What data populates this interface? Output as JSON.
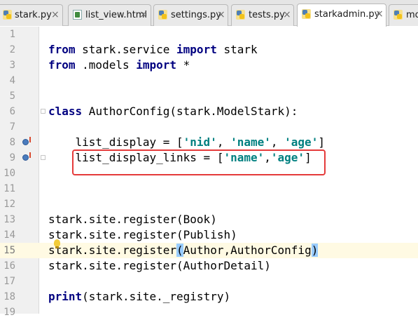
{
  "tabs": [
    {
      "label": "stark.py",
      "icon": "python-file-icon",
      "active": false
    },
    {
      "label": "list_view.html",
      "icon": "html-file-icon",
      "active": false
    },
    {
      "label": "settings.py",
      "icon": "python-file-icon",
      "active": false
    },
    {
      "label": "tests.py",
      "icon": "python-file-icon",
      "active": false
    },
    {
      "label": "starkadmin.py",
      "icon": "python-file-icon",
      "active": true
    },
    {
      "label": "mo",
      "icon": "python-file-icon",
      "active": false
    }
  ],
  "close_glyph": "×",
  "line_numbers": [
    "1",
    "2",
    "3",
    "4",
    "5",
    "6",
    "7",
    "8",
    "9",
    "10",
    "11",
    "12",
    "13",
    "14",
    "15",
    "16",
    "17",
    "18",
    "19"
  ],
  "code": {
    "l2": {
      "kw1": "from",
      "mod": " stark.service ",
      "kw2": "import",
      "rest": " stark"
    },
    "l3": {
      "kw1": "from",
      "mod": " .models ",
      "kw2": "import",
      "rest": " *"
    },
    "l6": {
      "kw": "class",
      "rest": " AuthorConfig(stark.ModelStark):"
    },
    "l8": {
      "pre": "    list_display = [",
      "s1": "'nid'",
      "c1": ", ",
      "s2": "'name'",
      "c2": ", ",
      "s3": "'age'",
      "post": "]"
    },
    "l9": {
      "pre": "    list_display_links = [",
      "s1": "'name'",
      "c1": ",",
      "s2": "'age'",
      "post": "]"
    },
    "l13": "stark.site.register(Book)",
    "l14": "stark.site.register(Publish)",
    "l15": {
      "pre": "stark.site.register",
      "open": "(",
      "mid": "Author,AuthorConfig",
      "close": ")"
    },
    "l16": "stark.site.register(AuthorDetail)",
    "l18": {
      "kw": "print",
      "rest": "(stark.site._registry)"
    }
  }
}
